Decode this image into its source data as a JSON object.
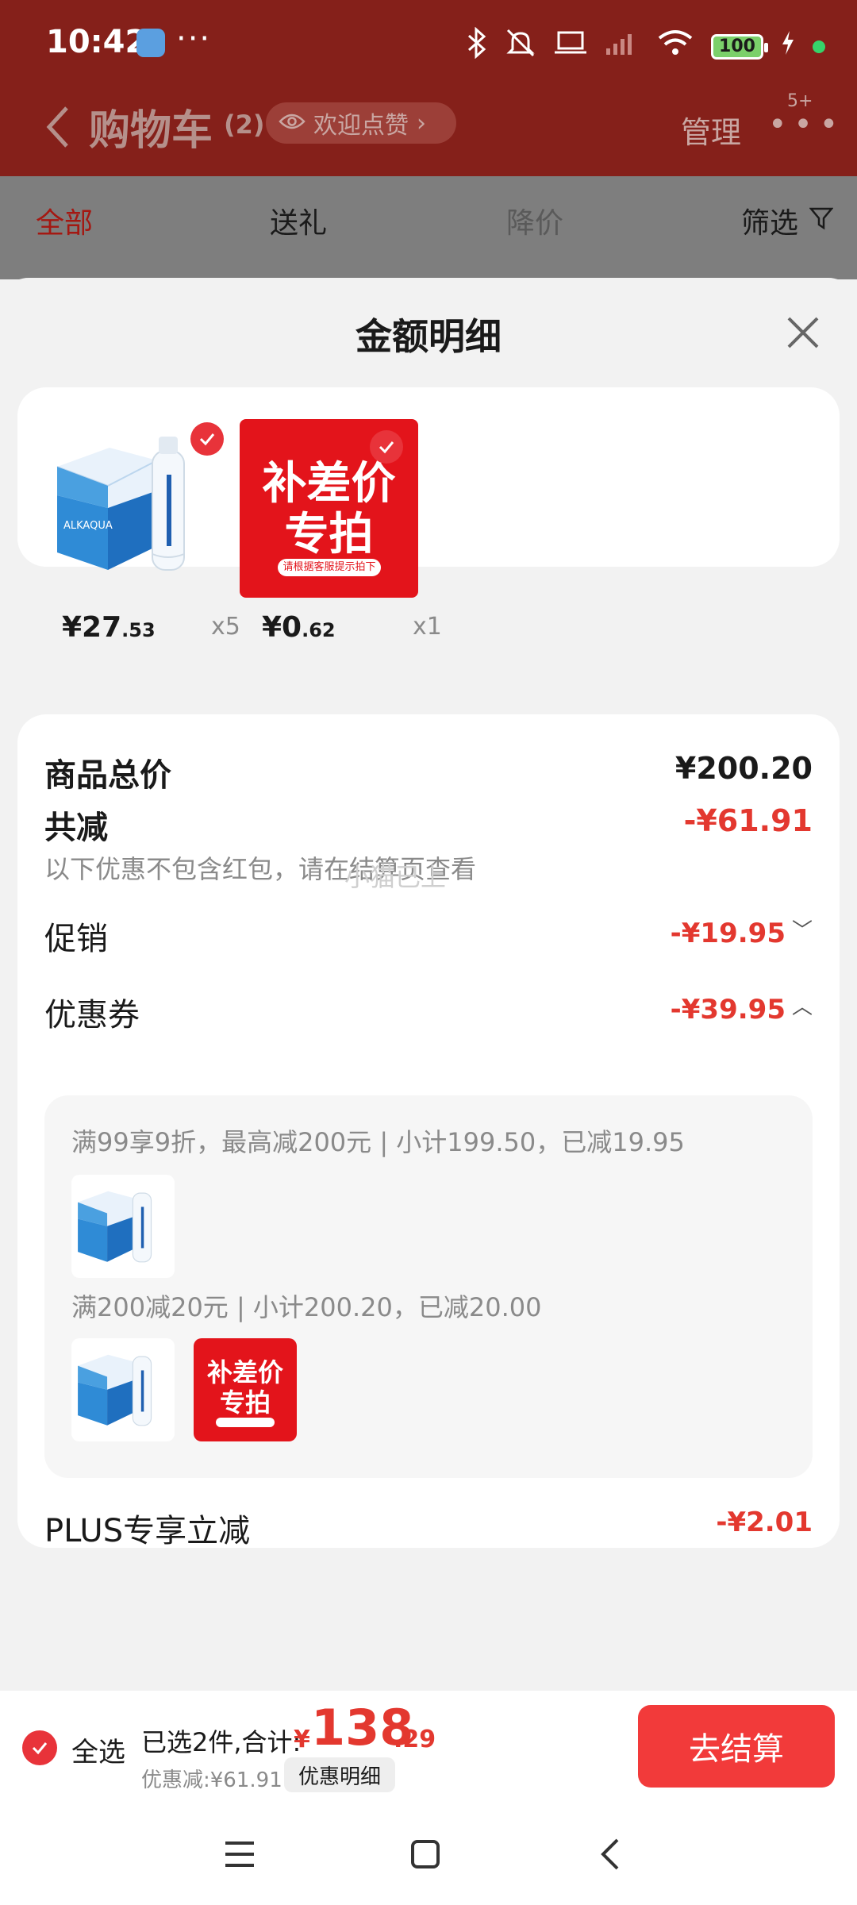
{
  "status": {
    "time": "10:42",
    "battery": "100"
  },
  "header": {
    "title": "购物车",
    "count": "(2)",
    "welcome": "欢迎点赞",
    "manage": "管理",
    "badge": "5+"
  },
  "tabs": {
    "all": "全部",
    "gift": "送礼",
    "price_drop": "降价",
    "filter": "筛选"
  },
  "sheet": {
    "title": "金额明细"
  },
  "products": [
    {
      "price_int": "¥27",
      "price_dec": ".53",
      "qty": "x5"
    },
    {
      "price_int": "¥0",
      "price_dec": ".62",
      "qty": "x1"
    }
  ],
  "promo_image": {
    "line1": "补差价",
    "line2": "专拍",
    "caption": "请根据客服提示拍下"
  },
  "water_brand": "ALKAQUA",
  "details": {
    "total_label": "商品总价",
    "total_value": "¥200.20",
    "reduce_label": "共减",
    "reduce_value": "-¥61.91",
    "note": "以下优惠不包含红包，请在结算页查看",
    "watermark": "小猫已上",
    "promo_label": "促销",
    "promo_value": "-¥19.95",
    "coupon_label": "优惠券",
    "coupon_value": "-¥39.95",
    "coupon_rule_1": "满99享9折，最高减200元 | 小计199.50，已减19.95",
    "coupon_rule_2": "满200减20元 | 小计200.20，已减20.00",
    "plus_label": "PLUS专享立减",
    "plus_value": "-¥2.01"
  },
  "bottom": {
    "select_all": "全选",
    "total_label": "已选2件,合计:",
    "currency": "¥",
    "total_int": "138",
    "total_dec": ".29",
    "discount": "优惠减:¥61.91",
    "detail_button": "优惠明细",
    "checkout": "去结算"
  },
  "colors": {
    "accent": "#e3382f",
    "header_bg": "#85201a",
    "checkout_bg": "#f23a3a"
  }
}
